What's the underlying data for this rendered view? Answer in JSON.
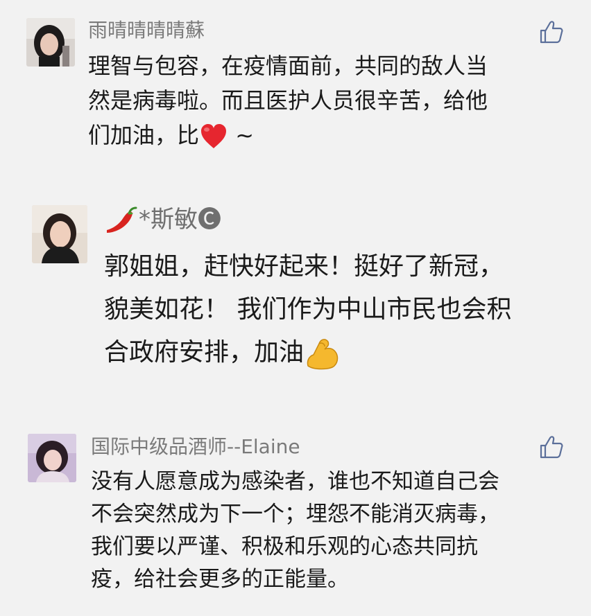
{
  "comments": [
    {
      "username": "雨晴晴晴晴蘇",
      "lines": [
        "理智与包容，在疫情面前，共同的敌人当",
        "然是病毒啦。而且医护人员很辛苦，给他"
      ],
      "last_line_text": "们加油，比",
      "last_line_suffix": " ~",
      "liked": false
    },
    {
      "username": "*斯敏🅒",
      "lines": [
        "郭姐姐，赶快好起来！挺好了新冠，",
        "貌美如花！ 我们作为中山市民也会积"
      ],
      "last_line_text": "合政府安排，加油"
    },
    {
      "username": "国际中级品酒师--Elaine",
      "lines": [
        "没有人愿意成为感染者，谁也不知道自己会",
        "不会突然成为下一个；埋怨不能消灭病毒，",
        "我们要以严谨、积极和乐观的心态共同抗",
        "疫，给社会更多的正能量。"
      ],
      "liked": false
    }
  ],
  "icons": {
    "like": "thumbs-up-icon",
    "heart": "red-heart-emoji",
    "pepper": "chili-pepper-emoji",
    "muscle": "flexed-biceps-emoji"
  },
  "colors": {
    "background": "#f2f2f2",
    "username": "#7a7a7a",
    "text": "#1a1a1a",
    "like_icon": "#5b6f9a"
  }
}
